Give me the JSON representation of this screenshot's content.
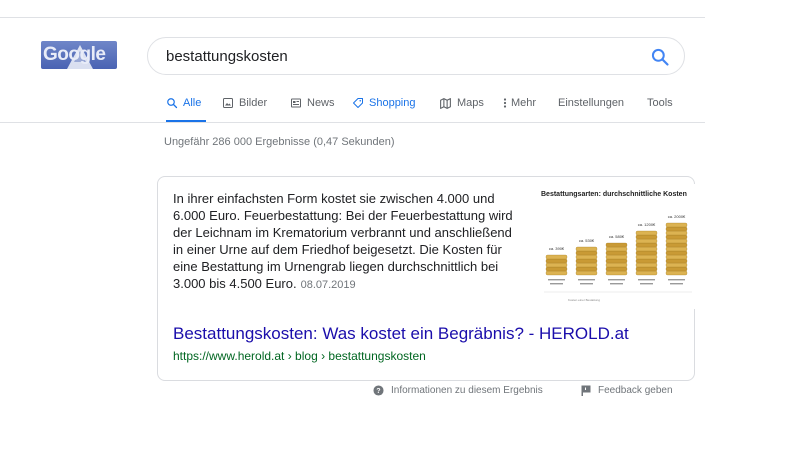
{
  "logo": {
    "text": "Google"
  },
  "search": {
    "query": "bestattungskosten"
  },
  "tabs": [
    {
      "label": "Alle",
      "icon": "search-icon",
      "active": true
    },
    {
      "label": "Bilder",
      "icon": "image-icon"
    },
    {
      "label": "News",
      "icon": "news-icon"
    },
    {
      "label": "Shopping",
      "icon": "tag-icon"
    },
    {
      "label": "Maps",
      "icon": "map-icon"
    },
    {
      "label": "Mehr",
      "icon": "more-vertical-icon"
    },
    {
      "label": "Einstellungen"
    },
    {
      "label": "Tools"
    }
  ],
  "result_stats": "Ungefähr 286 000 Ergebnisse (0,47 Sekunden)",
  "featured_snippet": {
    "text": "In ihrer einfachsten Form kostet sie zwischen 4.000 und 6.000 Euro. Feuerbestattung: Bei der Feuerbestattung wird der Leichnam im Krematorium verbrannt und anschließend in einer Urne auf dem Friedhof beigesetzt. Die Kosten für eine Bestattung im Urnengrab liegen durchschnittlich bei 3.000 bis 4.500 Euro.",
    "date": "08.07.2019",
    "image": {
      "title": "Bestattungsarten: durchschnittliche Kosten",
      "price_labels": [
        "ca. 390€",
        "ca. 530€",
        "ca. 580€",
        "ca. 1200€",
        "ca. 2000€"
      ],
      "footnote": "Kosten einer Bestattung"
    },
    "title": "Bestattungskosten: Was kostet ein Begräbnis? - HEROLD.at",
    "url": "https://www.herold.at › blog › bestattungskosten"
  },
  "footer": {
    "info_label": "Informationen zu diesem Ergebnis",
    "feedback_label": "Feedback geben"
  },
  "colors": {
    "link": "#1a0dab",
    "url_green": "#006621",
    "accent_blue": "#1a73e8",
    "gray_text": "#70757a"
  }
}
